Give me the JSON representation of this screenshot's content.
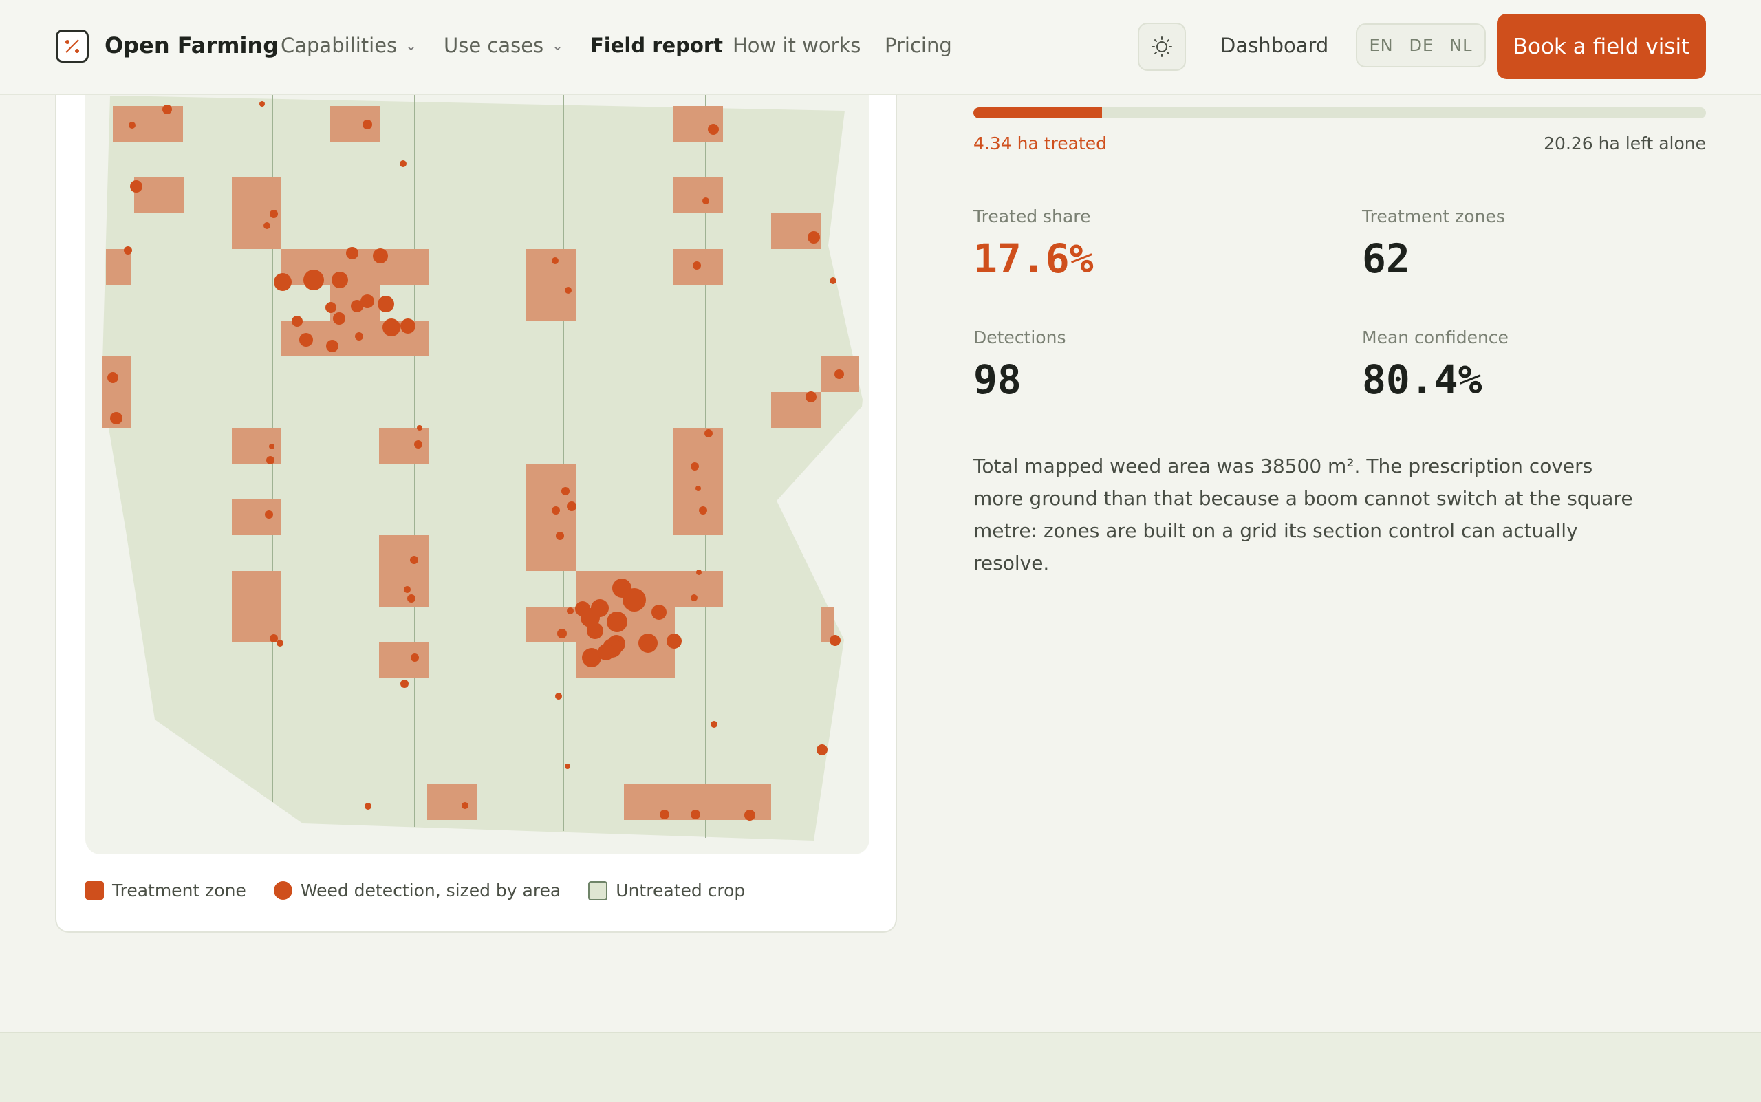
{
  "header": {
    "brand": "Open Farming",
    "nav": [
      {
        "label": "Capabilities",
        "dropdown": true
      },
      {
        "label": "Use cases",
        "dropdown": true
      },
      {
        "label": "Field report",
        "active": true
      },
      {
        "label": "How it works"
      },
      {
        "label": "Pricing"
      }
    ],
    "theme_icon": "sun-icon",
    "dashboard_label": "Dashboard",
    "languages": [
      "EN",
      "DE",
      "NL"
    ],
    "cta_label": "Book a field visit"
  },
  "map": {
    "legend": {
      "zone": "Treatment zone",
      "detection": "Weed detection, sized by area",
      "crop": "Untreated crop"
    }
  },
  "report": {
    "treated_label": "4.34 ha treated",
    "left_label": "20.26 ha left alone",
    "treated_fraction": 0.176,
    "stats": {
      "treated_share": {
        "label": "Treated share",
        "value": "17.6%"
      },
      "zones": {
        "label": "Treatment zones",
        "value": "62"
      },
      "detections": {
        "label": "Detections",
        "value": "98"
      },
      "confidence": {
        "label": "Mean confidence",
        "value": "80.4%"
      }
    },
    "description": "Total mapped weed area was 38500 m². The prescription covers more ground than that because a boom cannot switch at the square metre: zones are built on a grid its section control can actually resolve."
  },
  "colors": {
    "accent": "#cf4f1c",
    "zone_fill": "#d99a77",
    "crop_fill": "#dfe6d2",
    "tramline": "#9fb293"
  }
}
